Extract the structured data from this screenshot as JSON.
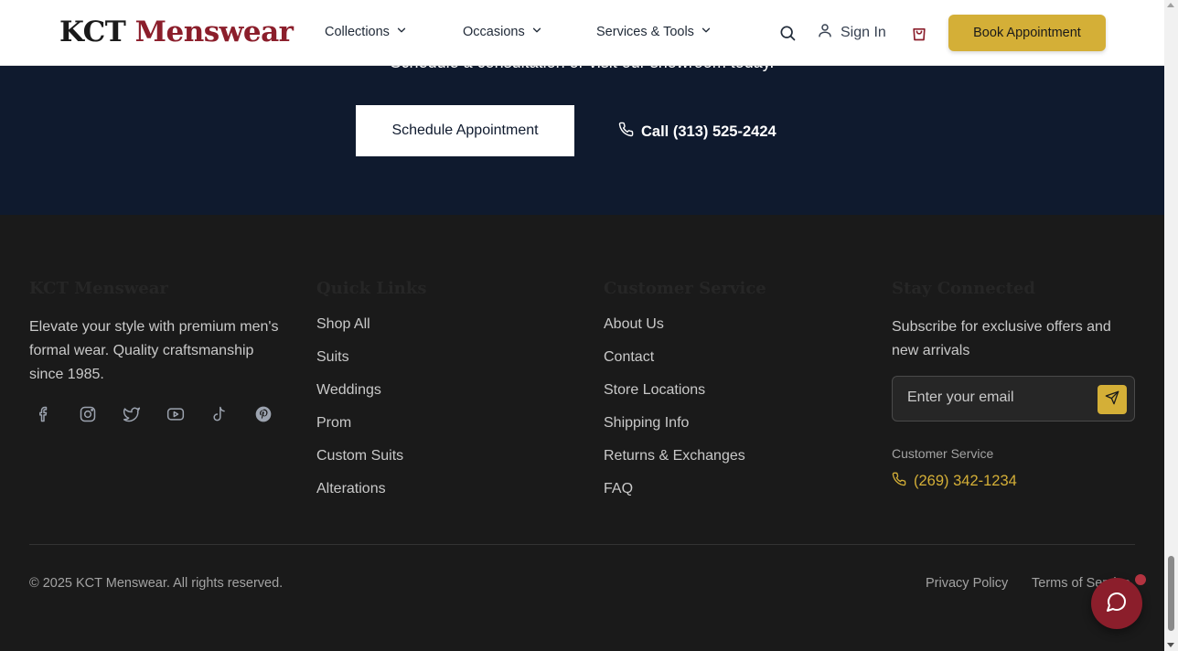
{
  "header": {
    "logo_part1": "KCT",
    "logo_part2": "Menswear",
    "nav": [
      "Collections",
      "Occasions",
      "Services & Tools"
    ],
    "signin": "Sign In",
    "book": "Book Appointment"
  },
  "cta": {
    "subtitle": "Schedule a consultation or visit our showroom today.",
    "schedule": "Schedule Appointment",
    "call": "Call (313) 525-2424"
  },
  "footer": {
    "brand": {
      "title": "KCT Menswear",
      "text": "Elevate your style with premium men's formal wear. Quality craftsmanship since 1985.",
      "socials": [
        "facebook-icon",
        "instagram-icon",
        "twitter-icon",
        "youtube-icon",
        "tiktok-icon",
        "pinterest-icon"
      ]
    },
    "quick_links": {
      "title": "Quick Links",
      "items": [
        "Shop All",
        "Suits",
        "Weddings",
        "Prom",
        "Custom Suits",
        "Alterations"
      ]
    },
    "customer_service": {
      "title": "Customer Service",
      "items": [
        "About Us",
        "Contact",
        "Store Locations",
        "Shipping Info",
        "Returns & Exchanges",
        "FAQ"
      ]
    },
    "connected": {
      "title": "Stay Connected",
      "text": "Subscribe for exclusive offers and new arrivals",
      "email_placeholder": "Enter your email",
      "cs_label": "Customer Service",
      "cs_phone": "(269) 342-1234"
    },
    "copyright": "© 2025 KCT Menswear. All rights reserved.",
    "privacy": "Privacy Policy",
    "terms": "Terms of Service"
  },
  "colors": {
    "accent_gold": "#d4af37",
    "brand_red": "#8b1e2b",
    "navy": "#0f1a2e",
    "footer_bg": "#1a1a1a"
  }
}
